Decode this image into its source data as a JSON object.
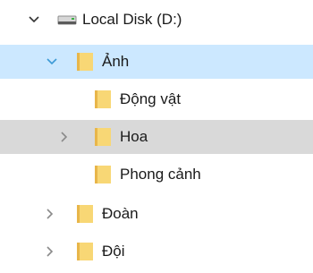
{
  "tree": {
    "drive": {
      "label": "Local Disk (D:)",
      "expanded": true,
      "icon": "drive-icon"
    },
    "items": [
      {
        "label": "Ảnh",
        "expanded": true,
        "selected": true,
        "icon": "folder-icon"
      },
      {
        "label": "Động vật",
        "icon": "folder-icon"
      },
      {
        "label": "Hoa",
        "collapsed": true,
        "hovered": true,
        "icon": "folder-icon"
      },
      {
        "label": "Phong cảnh",
        "icon": "folder-icon"
      },
      {
        "label": "Đoàn",
        "collapsed": true,
        "icon": "folder-icon"
      },
      {
        "label": "Đội",
        "collapsed": true,
        "icon": "folder-icon"
      }
    ]
  },
  "colors": {
    "selected_bg": "#cce8ff",
    "hover_bg": "#d9d9d9",
    "folder": "#f8d775",
    "folder_shadow": "#e8b64a",
    "chevron_expanded_selected": "#3c9ad6",
    "chevron": "#8a8a8a"
  }
}
